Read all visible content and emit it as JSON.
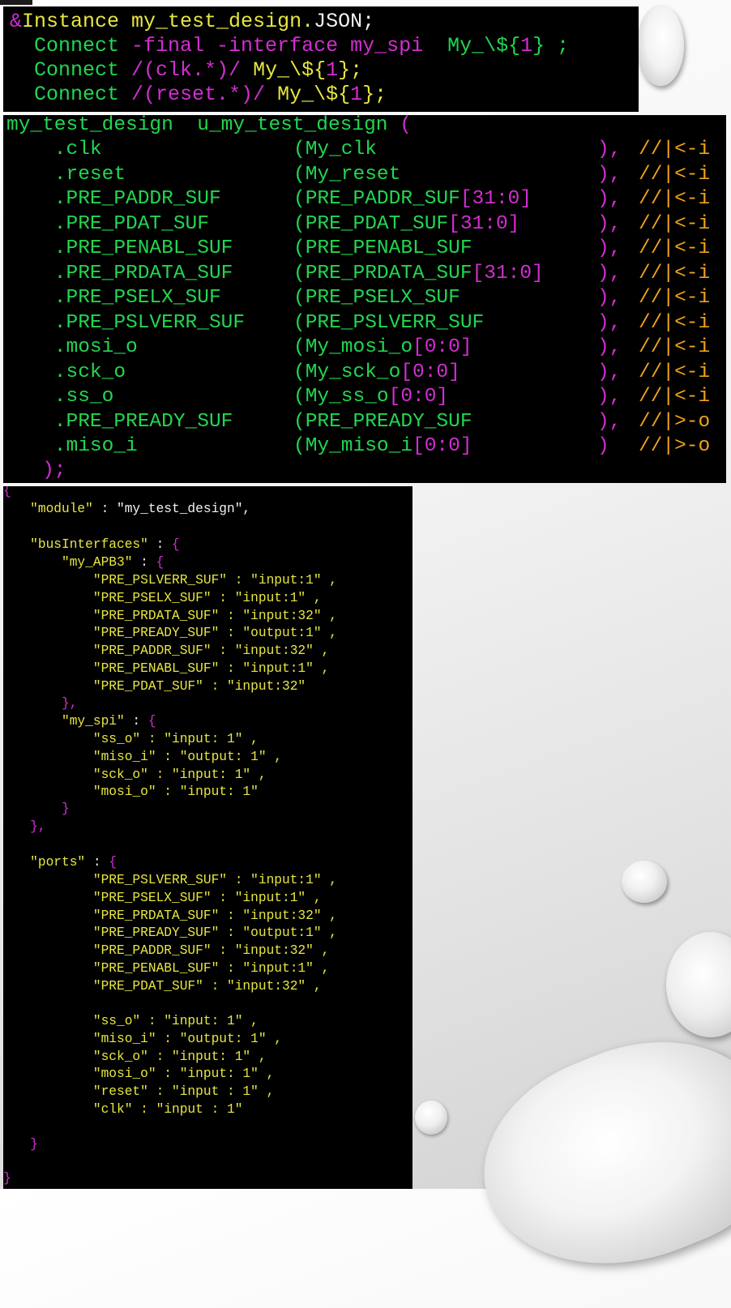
{
  "panel1": {
    "line1": {
      "a": "&",
      "b": "Instance my_test_design.",
      "c": "JSON;"
    },
    "line2": {
      "a": "  Connect ",
      "b": "-final -interface my_spi  ",
      "c": "My_\\${",
      "d": "1",
      "e": "} ;"
    },
    "line3": {
      "a": "  Connect ",
      "b": "/(clk.*)/ ",
      "c": "My_\\${",
      "d": "1",
      "e": "};"
    },
    "line4": {
      "a": "  Connect ",
      "b": "/(reset.*)/ ",
      "c": "My_\\${",
      "d": "1",
      "e": "};"
    }
  },
  "panel2": {
    "header": {
      "a": "my_test_design  u_my_test_design ",
      "b": "("
    },
    "rows": [
      {
        "port": "    .clk",
        "sig": "(My_clk",
        "idx": "",
        "close": "), ",
        "cmt": "//|<-i"
      },
      {
        "port": "    .reset",
        "sig": "(My_reset",
        "idx": "",
        "close": "), ",
        "cmt": "//|<-i"
      },
      {
        "port": "    .PRE_PADDR_SUF",
        "sig": "(PRE_PADDR_SUF",
        "idx": "[31:0]",
        "close": "), ",
        "cmt": "//|<-i"
      },
      {
        "port": "    .PRE_PDAT_SUF",
        "sig": "(PRE_PDAT_SUF",
        "idx": "[31:0]",
        "close": "), ",
        "cmt": "//|<-i"
      },
      {
        "port": "    .PRE_PENABL_SUF",
        "sig": "(PRE_PENABL_SUF",
        "idx": "",
        "close": "), ",
        "cmt": "//|<-i"
      },
      {
        "port": "    .PRE_PRDATA_SUF",
        "sig": "(PRE_PRDATA_SUF",
        "idx": "[31:0]",
        "close": "), ",
        "cmt": "//|<-i"
      },
      {
        "port": "    .PRE_PSELX_SUF",
        "sig": "(PRE_PSELX_SUF",
        "idx": "",
        "close": "), ",
        "cmt": "//|<-i"
      },
      {
        "port": "    .PRE_PSLVERR_SUF",
        "sig": "(PRE_PSLVERR_SUF",
        "idx": "",
        "close": "), ",
        "cmt": "//|<-i"
      },
      {
        "port": "    .mosi_o",
        "sig": "(My_mosi_o",
        "idx": "[0:0]",
        "close": "), ",
        "cmt": "//|<-i"
      },
      {
        "port": "    .sck_o",
        "sig": "(My_sck_o",
        "idx": "[0:0]",
        "close": "), ",
        "cmt": "//|<-i"
      },
      {
        "port": "    .ss_o",
        "sig": "(My_ss_o",
        "idx": "[0:0]",
        "close": "), ",
        "cmt": "//|<-i"
      },
      {
        "port": "    .PRE_PREADY_SUF",
        "sig": "(PRE_PREADY_SUF",
        "idx": "",
        "close": "), ",
        "cmt": "//|>-o"
      },
      {
        "port": "    .miso_i",
        "sig": "(My_miso_i",
        "idx": "[0:0]",
        "close": ")  ",
        "cmt": "//|>-o"
      }
    ],
    "footer": "   );"
  },
  "panel3": {
    "open_brace": "{",
    "module_key": "   \"module\"",
    "module_val": " : \"my_test_design\",",
    "bus_key": "   \"busInterfaces\"",
    "bus_sep": " : ",
    "bus_open": "{",
    "apb_key": "       \"my_APB3\"",
    "apb_sep": " : ",
    "apb_open": "{",
    "apb_entries": [
      "           \"PRE_PSLVERR_SUF\" : \"input:1\" ,",
      "           \"PRE_PSELX_SUF\" : \"input:1\" ,",
      "           \"PRE_PRDATA_SUF\" : \"input:32\" ,",
      "           \"PRE_PREADY_SUF\" : \"output:1\" ,",
      "           \"PRE_PADDR_SUF\" : \"input:32\" ,",
      "           \"PRE_PENABL_SUF\" : \"input:1\" ,",
      "           \"PRE_PDAT_SUF\" : \"input:32\""
    ],
    "apb_close": "       },",
    "spi_key": "       \"my_spi\"",
    "spi_sep": " : ",
    "spi_open": "{",
    "spi_entries": [
      "           \"ss_o\" : \"input: 1\" ,",
      "           \"miso_i\" : \"output: 1\" ,",
      "           \"sck_o\" : \"input: 1\" ,",
      "           \"mosi_o\" : \"input: 1\""
    ],
    "spi_close": "       }",
    "bus_close": "   },",
    "ports_key": "   \"ports\"",
    "ports_sep": " : ",
    "ports_open": "{",
    "ports_entries_a": [
      "           \"PRE_PSLVERR_SUF\" : \"input:1\" ,",
      "           \"PRE_PSELX_SUF\" : \"input:1\" ,",
      "           \"PRE_PRDATA_SUF\" : \"input:32\" ,",
      "           \"PRE_PREADY_SUF\" : \"output:1\" ,",
      "           \"PRE_PADDR_SUF\" : \"input:32\" ,",
      "           \"PRE_PENABL_SUF\" : \"input:1\" ,",
      "           \"PRE_PDAT_SUF\" : \"input:32\" ,"
    ],
    "ports_entries_b": [
      "           \"ss_o\" : \"input: 1\" ,",
      "           \"miso_i\" : \"output: 1\" ,",
      "           \"sck_o\" : \"input: 1\" ,",
      "           \"mosi_o\" : \"input: 1\" ,",
      "           \"reset\" : \"input : 1\" ,",
      "           \"clk\" : \"input : 1\""
    ],
    "ports_close": "   }",
    "close_brace": "}"
  }
}
